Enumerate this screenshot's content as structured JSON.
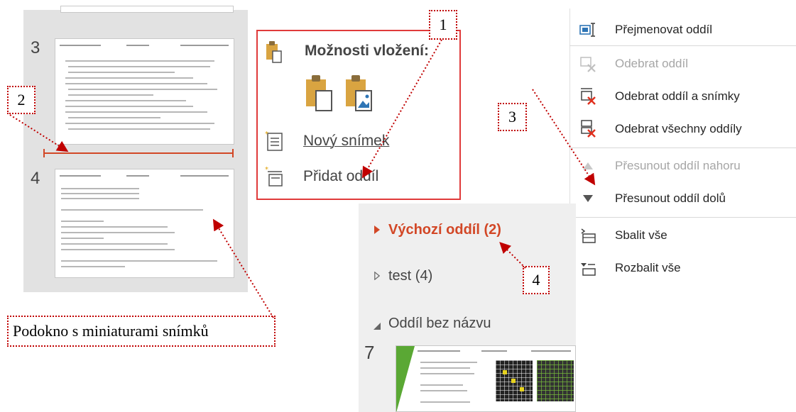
{
  "thumbnails": {
    "slides": [
      {
        "number": "3"
      },
      {
        "number": "4"
      }
    ],
    "caption": "Podokno s miniaturami snímků"
  },
  "callouts": {
    "c1": "1",
    "c2": "2",
    "c3": "3",
    "c4": "4"
  },
  "paste_panel": {
    "title": "Možnosti vložení:",
    "new_slide": "Nový snímek",
    "add_section": "Přidat oddíl"
  },
  "context_menu": {
    "items": [
      {
        "label": "Přejmenovat oddíl",
        "enabled": true,
        "icon": "rename-icon"
      },
      {
        "label": "Odebrat oddíl",
        "enabled": false,
        "icon": "remove-section-icon"
      },
      {
        "label": "Odebrat oddíl a snímky",
        "enabled": true,
        "icon": "remove-section-slides-icon"
      },
      {
        "label": "Odebrat všechny oddíly",
        "enabled": true,
        "icon": "remove-all-sections-icon"
      },
      {
        "label": "Přesunout oddíl nahoru",
        "enabled": false,
        "icon": "triangle-up-icon"
      },
      {
        "label": "Přesunout oddíl dolů",
        "enabled": true,
        "icon": "triangle-down-icon"
      },
      {
        "label": "Sbalit vše",
        "enabled": true,
        "icon": "collapse-all-icon"
      },
      {
        "label": "Rozbalit vše",
        "enabled": true,
        "icon": "expand-all-icon"
      }
    ]
  },
  "sections_panel": {
    "sections": [
      {
        "name": "Výchozí oddíl (2)",
        "state": "collapsed",
        "selected": true
      },
      {
        "name": "test (4)",
        "state": "collapsed",
        "selected": false
      },
      {
        "name": "Oddíl bez názvu",
        "state": "expanded",
        "selected": false
      }
    ],
    "slide_number": "7"
  },
  "colors": {
    "accent": "#d24726",
    "callout_border": "#c00000",
    "disabled": "#a6a6a6",
    "icon_red": "#e0301e"
  }
}
